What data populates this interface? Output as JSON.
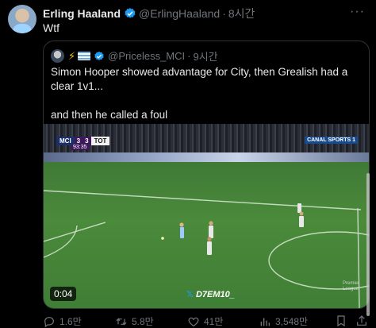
{
  "post": {
    "author_name": "Erling Haaland",
    "author_handle": "@ErlingHaaland",
    "time": "8시간",
    "text": "Wtf"
  },
  "quote": {
    "author_handle": "@Priceless_MCI",
    "time": "9시간",
    "text_line1": "Simon Hooper showed advantage for City, then Grealish had a clear 1v1...",
    "text_line2": "and then he called a foul",
    "video": {
      "duration": "0:04",
      "home_team": "MCI",
      "home_score": "3",
      "away_score": "3",
      "away_team": "TOT",
      "clock": "93:35",
      "watermark": "D7EM10_"
    }
  },
  "actions": {
    "replies": "1.6만",
    "reposts": "5.8만",
    "likes": "41만",
    "views": "3,548만"
  },
  "colors": {
    "background": "#000000",
    "text": "#e7e9ea",
    "muted": "#71767b",
    "verified": "#1d9bf0",
    "border": "#2f3336"
  }
}
